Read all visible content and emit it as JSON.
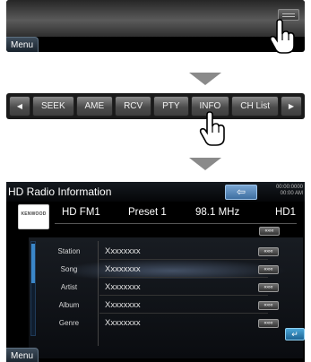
{
  "panel1": {
    "menu_label": "Menu",
    "handle_icon": "drag-handle-icon"
  },
  "toolbar": {
    "buttons": [
      "◀",
      "SEEK",
      "AME",
      "RCV",
      "PTY",
      "INFO",
      "CH List",
      "▶"
    ]
  },
  "info_screen": {
    "title": "HD Radio Information",
    "back_label": "⇦",
    "clock_line1": "00:00:0000",
    "clock_line2": "00:00 AM",
    "logo_text": "KENWOOD",
    "band": "HD FM1",
    "preset": "Preset 1",
    "frequency": "98.1 MHz",
    "hd_channel": "HD1",
    "rows": [
      {
        "label": "Station",
        "value": "Xxxxxxxx"
      },
      {
        "label": "Song",
        "value": "Xxxxxxxx"
      },
      {
        "label": "Artist",
        "value": "Xxxxxxxx"
      },
      {
        "label": "Album",
        "value": "Xxxxxxxx"
      },
      {
        "label": "Genre",
        "value": "Xxxxxxxx"
      }
    ],
    "scroll_button_label": "«««",
    "return_label": "↵",
    "menu_label": "Menu"
  },
  "colors": {
    "accent_blue": "#3e6fa1",
    "panel_bg": "#000000",
    "arrow_gray": "#8a8a8a"
  }
}
